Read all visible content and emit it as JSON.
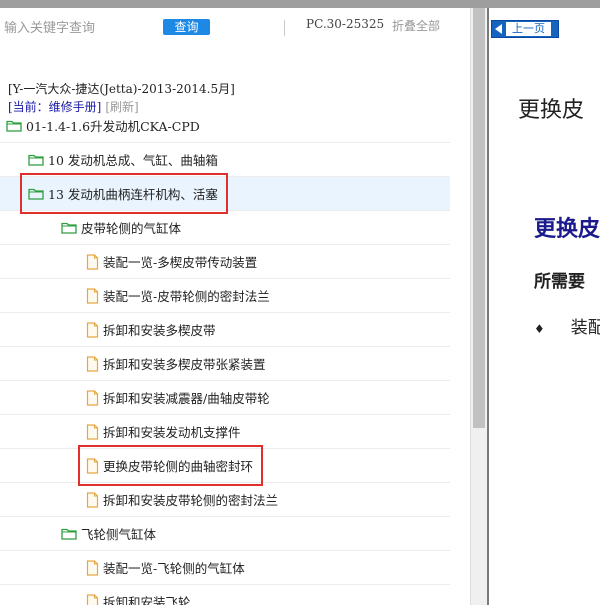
{
  "search": {
    "placeholder": "输入关键字查询",
    "button_label": "查询",
    "pc_code": "PC.30-25325",
    "collapse_all": "折叠全部"
  },
  "info": {
    "vehicle": "[Y-一汽大众-捷达(Jetta)-2013-2014.5月]",
    "current": "[当前：维修手册]",
    "refresh": "[刷新]"
  },
  "tree": [
    {
      "label": "01-1.4-1.6升发动机CKA-CPD",
      "icon": "folder-icon",
      "level": 0
    },
    {
      "label": "10 发动机总成、气缸、曲轴箱",
      "icon": "folder-icon",
      "level": 1
    },
    {
      "label": "13 发动机曲柄连杆机构、活塞",
      "icon": "folder-icon",
      "level": 1,
      "selected": true,
      "highlighted": true
    },
    {
      "label": "皮带轮侧的气缸体",
      "icon": "folder-icon",
      "level": 2
    },
    {
      "label": "装配一览-多楔皮带传动装置",
      "icon": "document-icon",
      "level": 3
    },
    {
      "label": "装配一览-皮带轮侧的密封法兰",
      "icon": "document-icon",
      "level": 3
    },
    {
      "label": "拆卸和安装多楔皮带",
      "icon": "document-icon",
      "level": 3
    },
    {
      "label": "拆卸和安装多楔皮带张紧装置",
      "icon": "document-icon",
      "level": 3
    },
    {
      "label": "拆卸和安装减震器/曲轴皮带轮",
      "icon": "document-icon",
      "level": 3
    },
    {
      "label": "拆卸和安装发动机支撑件",
      "icon": "document-icon",
      "level": 3
    },
    {
      "label": "更换皮带轮侧的曲轴密封环",
      "icon": "document-icon",
      "level": 3,
      "highlighted": true
    },
    {
      "label": "拆卸和安装皮带轮侧的密封法兰",
      "icon": "document-icon",
      "level": 3
    },
    {
      "label": "飞轮侧气缸体",
      "icon": "folder-icon",
      "level": 2
    },
    {
      "label": "装配一览-飞轮侧的气缸体",
      "icon": "document-icon",
      "level": 3
    },
    {
      "label": "拆卸和安装飞轮",
      "icon": "document-icon",
      "level": 3
    }
  ],
  "doc": {
    "prev_page": "上一页",
    "title": "更换皮",
    "heading": "更换皮",
    "subheading": "所需要",
    "bullet_mark": "♦",
    "bullet": "装配"
  },
  "colors": {
    "accent": "#1e88e5",
    "highlight": "#e0302d",
    "folder": "#2e9e3e",
    "document": "#e8a640",
    "heading": "#1a1a8c"
  }
}
